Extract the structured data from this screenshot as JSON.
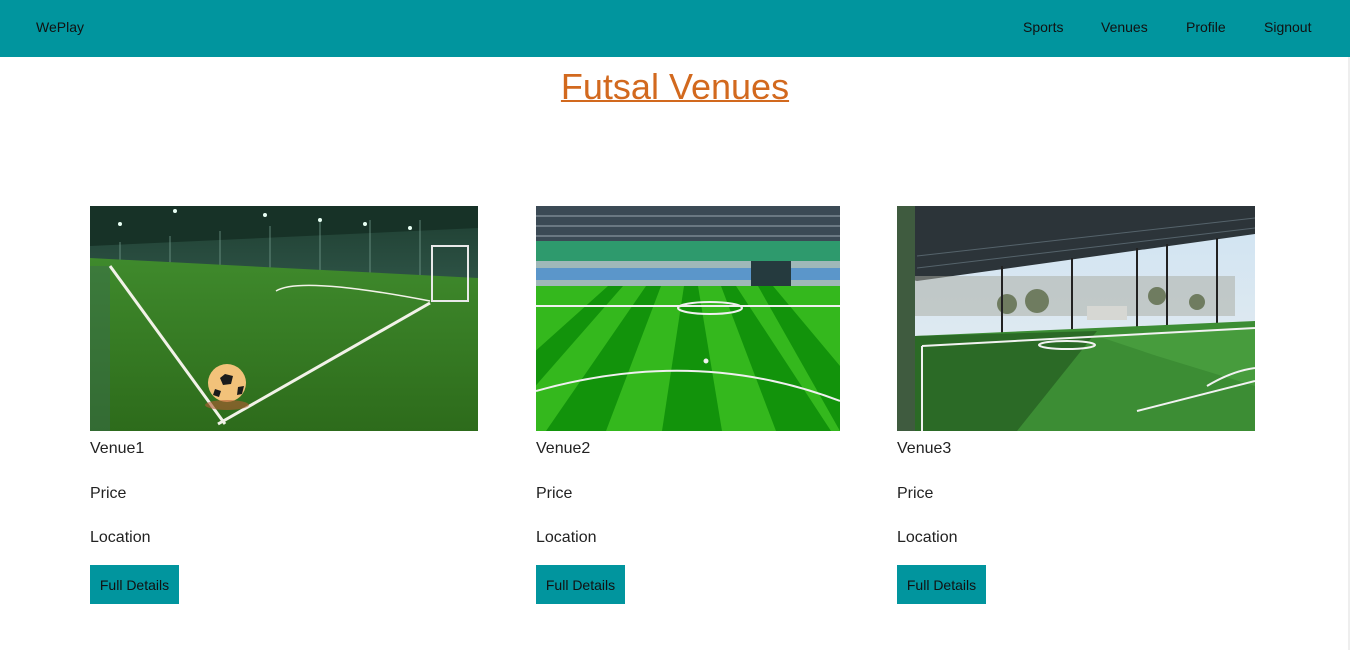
{
  "nav": {
    "brand": "WePlay",
    "links": [
      "Sports",
      "Venues",
      "Profile",
      "Signout"
    ]
  },
  "page_title": "Futsal Venues",
  "venues": [
    {
      "name": "Venue1",
      "price_label": "Price",
      "location_label": "Location",
      "button_label": "Full Details"
    },
    {
      "name": "Venue2",
      "price_label": "Price",
      "location_label": "Location",
      "button_label": "Full Details"
    },
    {
      "name": "Venue3",
      "price_label": "Price",
      "location_label": "Location",
      "button_label": "Full Details"
    }
  ],
  "colors": {
    "navbar": "#01959e",
    "title": "#d2691e",
    "button": "#01959e"
  }
}
